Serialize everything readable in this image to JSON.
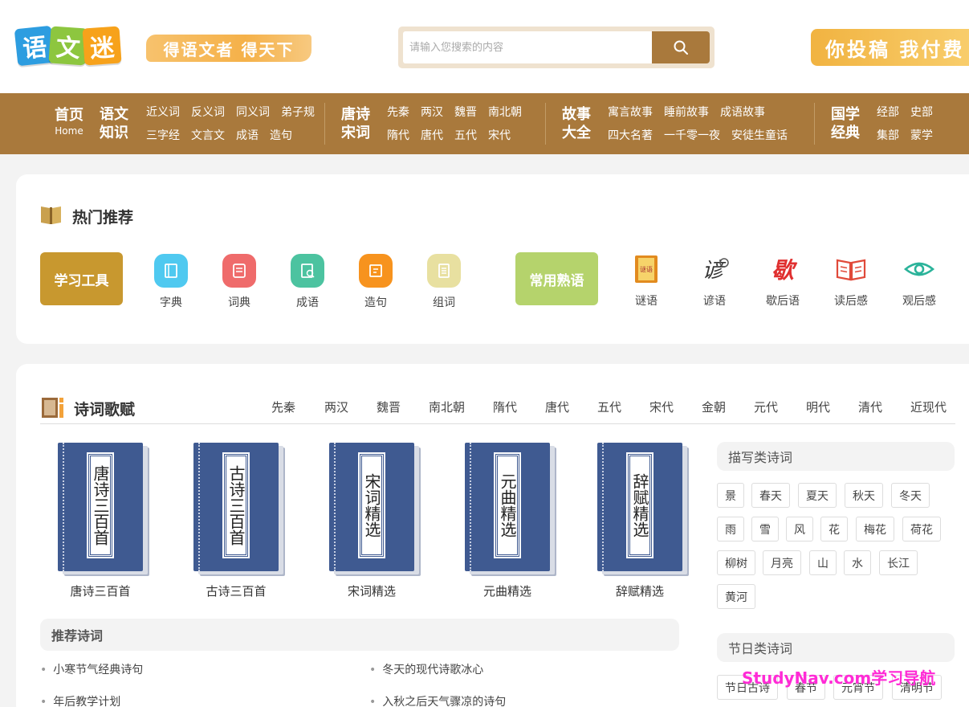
{
  "header": {
    "logo_chars": [
      "语",
      "文",
      "迷"
    ],
    "slogan": "得语文者 得天下",
    "search_placeholder": "请输入您搜索的内容",
    "promo": "你投稿 我付费"
  },
  "nav": {
    "home": "首页",
    "home_en": "Home",
    "groups": [
      {
        "title": [
          "语文",
          "知识"
        ],
        "links": [
          "近义词",
          "反义词",
          "同义词",
          "弟子规",
          "三字经",
          "文言文",
          "成语",
          "造句"
        ]
      },
      {
        "title": [
          "唐诗",
          "宋词"
        ],
        "links": [
          "先秦",
          "两汉",
          "魏晋",
          "南北朝",
          "隋代",
          "唐代",
          "五代",
          "宋代"
        ]
      },
      {
        "title": [
          "故事",
          "大全"
        ],
        "links": [
          "寓言故事",
          "睡前故事",
          "成语故事",
          "四大名著",
          "一千零一夜",
          "安徒生童话"
        ]
      },
      {
        "title": [
          "国学",
          "经典"
        ],
        "links": [
          "经部",
          "史部",
          "集部",
          "蒙学"
        ]
      }
    ]
  },
  "hot": {
    "title": "热门推荐",
    "study_tools": "学习工具",
    "tools": [
      {
        "label": "字典",
        "icon": "dictionary-icon",
        "color": "#4fc9f0"
      },
      {
        "label": "词典",
        "icon": "word-book-icon",
        "color": "#ef6b6b"
      },
      {
        "label": "成语",
        "icon": "idiom-icon",
        "color": "#4cc3a0"
      },
      {
        "label": "造句",
        "icon": "sentence-icon",
        "color": "#f7931e"
      },
      {
        "label": "组词",
        "icon": "compose-icon",
        "color": "#e8e0a0"
      }
    ],
    "common_phrases": "常用熟语",
    "phrases": [
      {
        "label": "谜语",
        "icon": "riddle-icon"
      },
      {
        "label": "谚语",
        "icon": "proverb-icon"
      },
      {
        "label": "歇后语",
        "icon": "xiehouyu-icon"
      },
      {
        "label": "读后感",
        "icon": "open-book-icon"
      },
      {
        "label": "观后感",
        "icon": "eye-icon"
      }
    ],
    "phrase_icon_text": {
      "riddle": "谜语",
      "proverb": "谚",
      "xiehouyu": "歇"
    }
  },
  "poems": {
    "title": "诗词歌赋",
    "dynasties": [
      "先秦",
      "两汉",
      "魏晋",
      "南北朝",
      "隋代",
      "唐代",
      "五代",
      "宋代",
      "金朝",
      "元代",
      "明代",
      "清代",
      "近现代"
    ],
    "books": [
      {
        "cover": "唐诗三百首",
        "label": "唐诗三百首"
      },
      {
        "cover": "古诗三百首",
        "label": "古诗三百首"
      },
      {
        "cover": "宋词精选",
        "label": "宋词精选"
      },
      {
        "cover": "元曲精选",
        "label": "元曲精选"
      },
      {
        "cover": "辞赋精选",
        "label": "辞赋精选"
      }
    ],
    "recommend_title": "推荐诗词",
    "recommend": [
      "小寒节气经典诗句",
      "冬天的现代诗歌冰心",
      "年后教学计划",
      "入秋之后天气骤凉的诗句"
    ],
    "describe_title": "描写类诗词",
    "describe_tags": [
      "景",
      "春天",
      "夏天",
      "秋天",
      "冬天",
      "雨",
      "雪",
      "风",
      "花",
      "梅花",
      "荷花",
      "柳树",
      "月亮",
      "山",
      "水",
      "长江",
      "黄河"
    ],
    "festival_title": "节日类诗词",
    "festival_tags": [
      "节日古诗",
      "春节",
      "元宵节",
      "清明节"
    ]
  },
  "watermark": "StudyNav.com学习导航"
}
